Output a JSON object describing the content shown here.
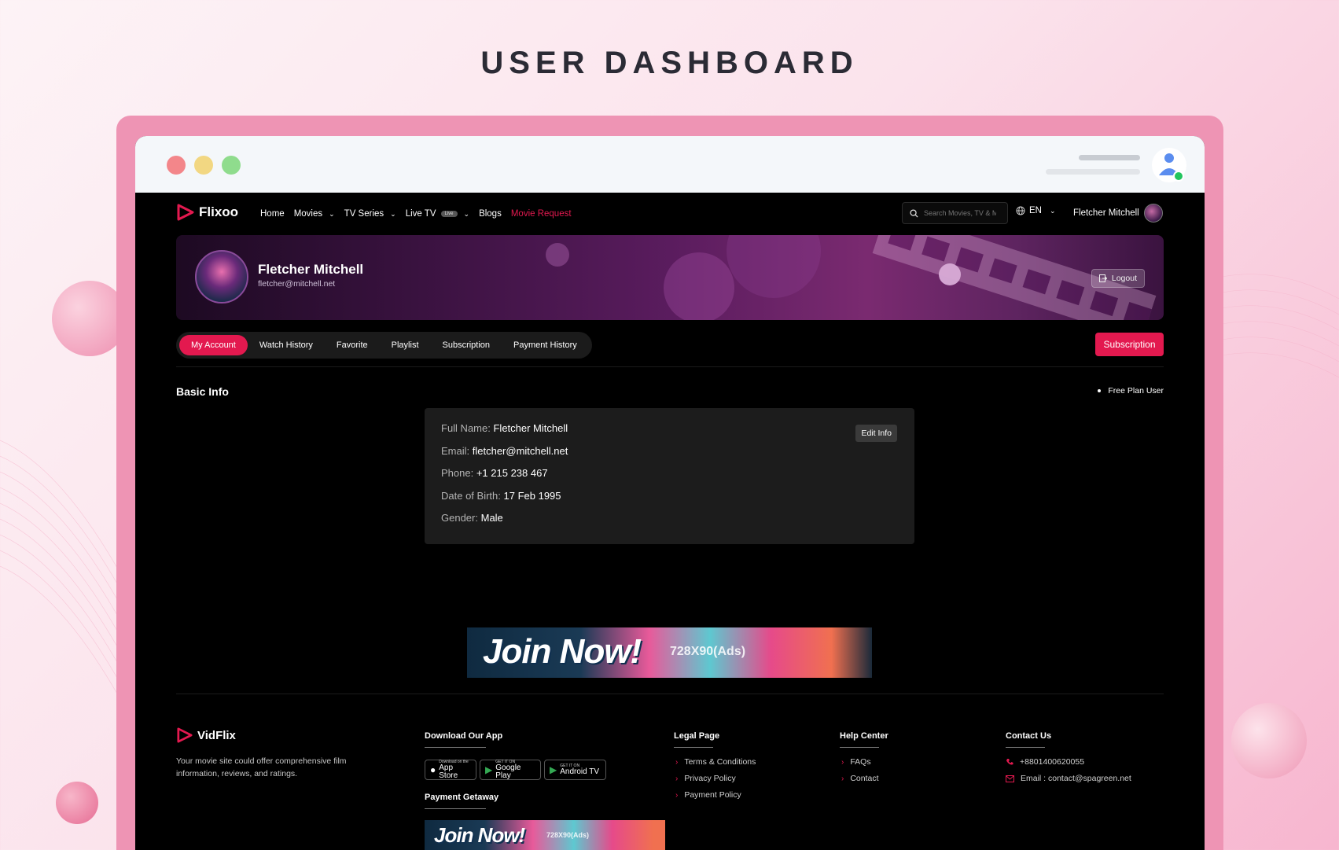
{
  "page_title": "USER DASHBOARD",
  "nav": {
    "brand": "Flixoo",
    "menu": [
      {
        "label": "Home",
        "dropdown": false
      },
      {
        "label": "Movies",
        "dropdown": true
      },
      {
        "label": "TV Series",
        "dropdown": true
      },
      {
        "label": "Live TV",
        "dropdown": true,
        "badge": "Live"
      },
      {
        "label": "Blogs",
        "dropdown": false
      },
      {
        "label": "Movie Request",
        "dropdown": false,
        "active": true
      }
    ],
    "search_placeholder": "Search Movies, TV & M",
    "language": "EN",
    "user_name": "Fletcher Mitchell"
  },
  "profile": {
    "name": "Fletcher Mitchell",
    "email": "fletcher@mitchell.net",
    "logout_label": "Logout"
  },
  "tabs": [
    "My Account",
    "Watch History",
    "Favorite",
    "Playlist",
    "Subscription",
    "Payment History"
  ],
  "active_tab": "My Account",
  "subscription_button": "Subscription",
  "basic_info": {
    "title": "Basic Info",
    "plan": "Free Plan User",
    "edit_label": "Edit Info",
    "rows": [
      {
        "label": "Full Name:",
        "value": "Fletcher Mitchell"
      },
      {
        "label": "Email:",
        "value": "fletcher@mitchell.net"
      },
      {
        "label": "Phone:",
        "value": "+1 215 238 467"
      },
      {
        "label": "Date of Birth:",
        "value": "17 Feb 1995"
      },
      {
        "label": "Gender:",
        "value": "Male"
      }
    ]
  },
  "ad": {
    "headline": "Join Now!",
    "size": "728X90(Ads)"
  },
  "footer": {
    "brand": "VidFlix",
    "description": "Your movie site could offer comprehensive film information, reviews, and ratings.",
    "download_title": "Download Our App",
    "stores": [
      {
        "small": "Download on the",
        "big": "App Store"
      },
      {
        "small": "GET IT ON",
        "big": "Google Play"
      },
      {
        "small": "GET IT ON",
        "big": "Android TV"
      }
    ],
    "payment_title": "Payment Getaway",
    "legal_title": "Legal Page",
    "legal_links": [
      "Terms & Conditions",
      "Privacy Policy",
      "Payment Policy"
    ],
    "help_title": "Help Center",
    "help_links": [
      "FAQs",
      "Contact"
    ],
    "contact_title": "Contact Us",
    "phone": "+8801400620055",
    "email": "Email : contact@spagreen.net"
  },
  "colors": {
    "accent": "#e3194f",
    "frame": "#ee94b4"
  }
}
